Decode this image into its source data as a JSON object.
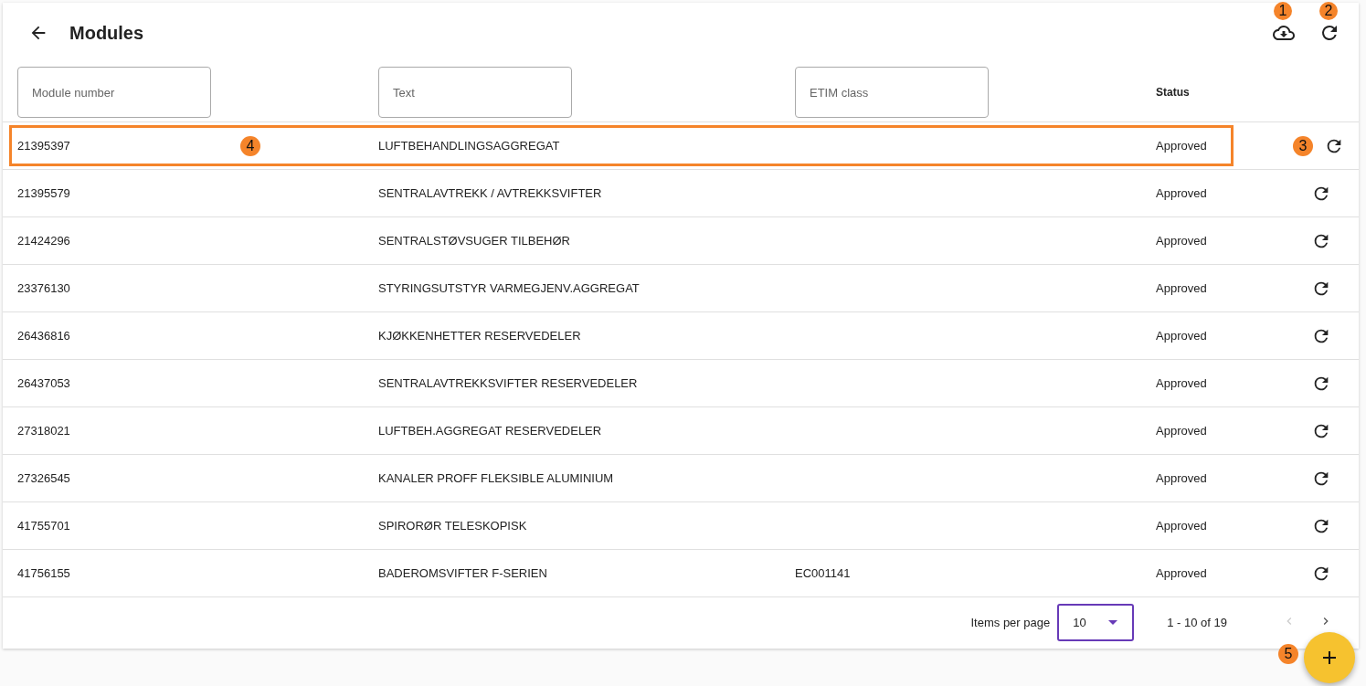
{
  "header": {
    "title": "Modules",
    "download_marker": "1",
    "refresh_marker": "2"
  },
  "filters": [
    {
      "placeholder": "Module number"
    },
    {
      "placeholder": "Text"
    },
    {
      "placeholder": "ETIM class"
    }
  ],
  "columns": {
    "status": "Status"
  },
  "rows": [
    {
      "number": "21395397",
      "text": "LUFTBEHANDLINGSAGGREGAT",
      "etim": "",
      "status": "Approved",
      "highlighted": true,
      "marker": "4",
      "action_marker": "3"
    },
    {
      "number": "21395579",
      "text": "SENTRALAVTREKK / AVTREKKSVIFTER",
      "etim": "",
      "status": "Approved",
      "highlighted": false
    },
    {
      "number": "21424296",
      "text": "SENTRALSTØVSUGER TILBEHØR",
      "etim": "",
      "status": "Approved",
      "highlighted": false
    },
    {
      "number": "23376130",
      "text": "STYRINGSUTSTYR VARMEGJENV.AGGREGAT",
      "etim": "",
      "status": "Approved",
      "highlighted": false
    },
    {
      "number": "26436816",
      "text": "KJØKKENHETTER RESERVEDELER",
      "etim": "",
      "status": "Approved",
      "highlighted": false
    },
    {
      "number": "26437053",
      "text": "SENTRALAVTREKKSVIFTER RESERVEDELER",
      "etim": "",
      "status": "Approved",
      "highlighted": false
    },
    {
      "number": "27318021",
      "text": "LUFTBEH.AGGREGAT RESERVEDELER",
      "etim": "",
      "status": "Approved",
      "highlighted": false
    },
    {
      "number": "27326545",
      "text": "KANALER PROFF FLEKSIBLE ALUMINIUM",
      "etim": "",
      "status": "Approved",
      "highlighted": false
    },
    {
      "number": "41755701",
      "text": "SPIRORØR TELESKOPISK",
      "etim": "",
      "status": "Approved",
      "highlighted": false
    },
    {
      "number": "41756155",
      "text": "BADEROMSVIFTER F-SERIEN",
      "etim": "EC001141",
      "status": "Approved",
      "highlighted": false
    }
  ],
  "paginator": {
    "label": "Items per page",
    "page_size": "10",
    "range": "1 - 10 of 19",
    "prev_disabled": true,
    "next_disabled": false
  },
  "fab": {
    "marker": "5"
  }
}
